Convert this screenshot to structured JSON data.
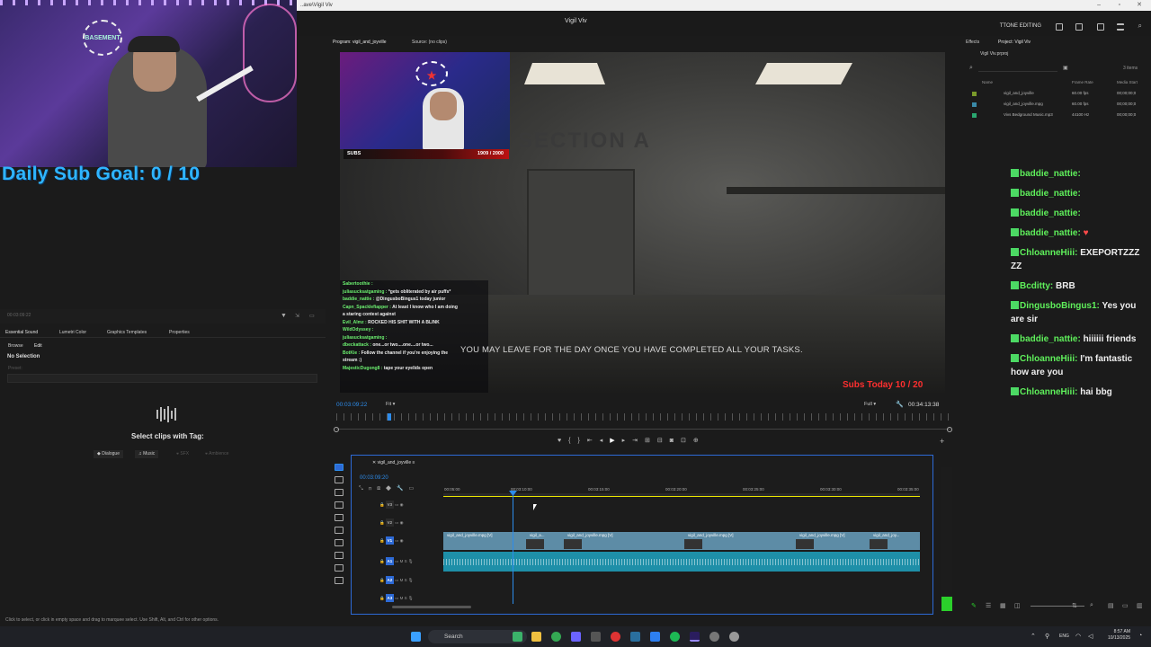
{
  "window": {
    "title": "Vigil Viv",
    "titlebar_text": "..ave\\Vigil Viv",
    "workspace": "TTONE EDITING"
  },
  "overlay": {
    "subgoal": "Daily Sub Goal:  0 / 10",
    "subs_label": "SUBS",
    "subs_count": "1909 / 2000",
    "subs_today": "Subs Today  10 / 20",
    "webcam_logo": "BASEMENT"
  },
  "left": {
    "time": "00:03:09:22",
    "tabs": [
      "Essential Sound",
      "Lumetri Color",
      "Graphics Templates",
      "Properties"
    ],
    "subtabs": [
      "Browse",
      "Edit"
    ],
    "no_selection": "No Selection",
    "preset_label": "Preset:",
    "select_clips": "Select clips with Tag:",
    "tags": [
      "Dialogue",
      "Music",
      "SFX",
      "Ambience"
    ],
    "status": "Click to select, or click in empty space and drag to marquee select. Use Shift, Alt, and Ctrl for other options."
  },
  "monitor": {
    "program_tab": "Program: vigil_and_joyville",
    "source_tab": "Source: (no clips)",
    "caption": "YOU MAY LEAVE FOR THE DAY ONCE YOU HAVE COMPLETED ALL YOUR TASKS.",
    "section_text": "SECTION A",
    "timecode": "00:03:09:22",
    "fit": "Fit",
    "quality": "Full",
    "duration": "00:34:13:38",
    "playhead_fraction": 0.083
  },
  "minichat": [
    {
      "user": "Sabertoothie :",
      "msg": ""
    },
    {
      "user": "juliasucksatgaming :",
      "msg": "*gets obliterated by air puffs*"
    },
    {
      "user": "baddie_nattie :",
      "msg": "@DingusboBingus1 today junior"
    },
    {
      "user": "Capn_Spacklefiapper :",
      "msg": "At least I know who I am doing"
    },
    {
      "user": "",
      "msg": "a staring contest against"
    },
    {
      "user": "Evil_Almz :",
      "msg": "ROCKED HIS SHIT WITH A BLINK"
    },
    {
      "user": "WildOdyssey :",
      "msg": ""
    },
    {
      "user": "juliasucksatgaming :",
      "msg": ""
    },
    {
      "user": "dbeckattack :",
      "msg": "one...or two....one....or two..."
    },
    {
      "user": "BotKie :",
      "msg": "Follow the channel if you're enjoying the"
    },
    {
      "user": "",
      "msg": "stream :)"
    },
    {
      "user": "MajesticDugong8 :",
      "msg": "tape your eyelids open"
    }
  ],
  "timeline": {
    "sequence": "vigil_and_joyville",
    "timecode": "00:03:09:20",
    "ruler": [
      "00:05:00",
      "00:03:10:00",
      "00:03:15:00",
      "00:03:20:00",
      "00:03:25:00",
      "00:03:30:00",
      "00:03:35:00"
    ],
    "tracks": [
      "V3",
      "V2",
      "V1",
      "A1",
      "A2",
      "A3"
    ],
    "track_labels": [
      "M",
      "S"
    ],
    "clips": [
      "vigil_and_joyville.mpg [V]",
      "vigil_a...",
      "vigil_and_joyville.mpg [V]",
      "vigil_and_joyville.mpg [V]",
      "vigil_and_joyville.mpg [V]",
      "vigil_and_joy..."
    ]
  },
  "project": {
    "tabs": [
      "Effects",
      "Project: Vigil Viv"
    ],
    "file": "Vigil Viv.prproj",
    "items_count": "3 items",
    "columns": [
      "Name",
      "Frame Rate",
      "Media Start"
    ],
    "rows": [
      {
        "name": "vigil_and_joyville",
        "rate": "60.00 fps",
        "start": "00;00;00;0",
        "color": "#7a9a2a"
      },
      {
        "name": "vigil_and_joyville.mpg",
        "rate": "60.00 fps",
        "start": "00;00;00;0",
        "color": "#3a8aa8"
      },
      {
        "name": "Vivs Bedground Music.mp3",
        "rate": "44100 Hz",
        "start": "00;00;00;0",
        "color": "#2aa870"
      }
    ]
  },
  "chat": [
    {
      "user": "baddie_nattie:",
      "msg": "",
      "badge": "#4cd964"
    },
    {
      "user": "baddie_nattie:",
      "msg": "",
      "badge": "#4cd964"
    },
    {
      "user": "baddie_nattie:",
      "msg": "",
      "badge": "#4cd964"
    },
    {
      "user": "baddie_nattie:",
      "msg": "♥",
      "badge": "#4cd964"
    },
    {
      "user": "ChloanneHiii:",
      "msg": "EXEPORTZZZ ZZ",
      "badge": "#4cd964"
    },
    {
      "user": "Bcditty:",
      "msg": "BRB",
      "badge": "#4cd964"
    },
    {
      "user": "DingusboBingus1:",
      "msg": "Yes you are sir",
      "badge": "#4cd964"
    },
    {
      "user": "baddie_nattie:",
      "msg": "hiiiiii friends",
      "badge": "#4cd964"
    },
    {
      "user": "ChloanneHiii:",
      "msg": "I'm fantastic how are you",
      "badge": "#4cd964"
    },
    {
      "user": "ChloanneHiii:",
      "msg": "hai bbg",
      "badge": "#4cd964"
    }
  ],
  "taskbar": {
    "search": "Search",
    "lang": "ENG",
    "time": "8:57 AM",
    "date": "10/13/2025"
  }
}
